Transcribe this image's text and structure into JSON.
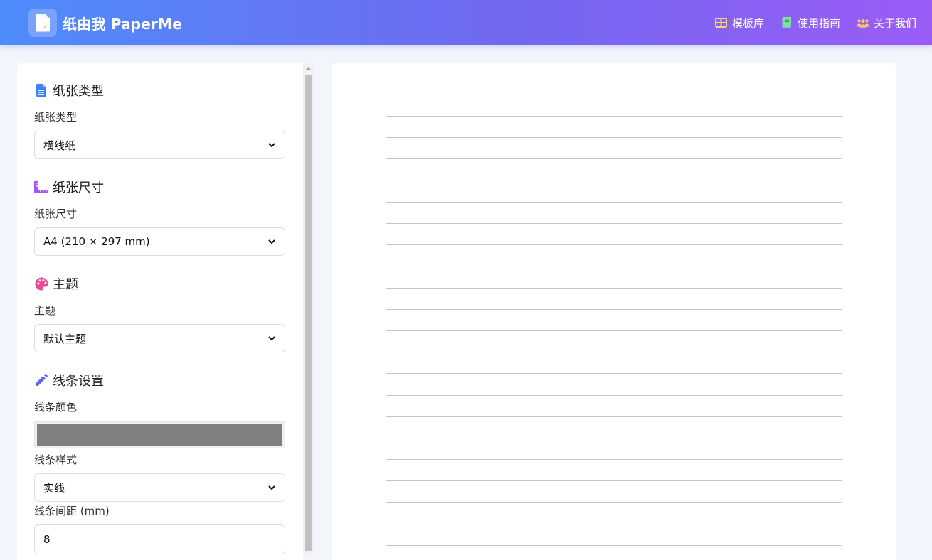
{
  "header": {
    "title": "纸由我 PaperMe",
    "nav": [
      {
        "label": "模板库",
        "icon": "table-icon"
      },
      {
        "label": "使用指南",
        "icon": "book-icon"
      },
      {
        "label": "关于我们",
        "icon": "users-icon"
      }
    ]
  },
  "panel": {
    "paper_type": {
      "title": "纸张类型",
      "label": "纸张类型",
      "value": "横线纸"
    },
    "paper_size": {
      "title": "纸张尺寸",
      "label": "纸张尺寸",
      "value": "A4 (210 × 297 mm)"
    },
    "theme": {
      "title": "主题",
      "label": "主题",
      "value": "默认主题"
    },
    "lines": {
      "title": "线条设置",
      "color_label": "线条颜色",
      "color_value": "#808080",
      "style_label": "线条样式",
      "style_value": "实线",
      "spacing_label": "线条间距 (mm)",
      "spacing_value": "8"
    }
  },
  "colors": {
    "header_gradient_start": "#4f8cfb",
    "header_gradient_end": "#9b5cf6",
    "page_background": "#f3f5fd",
    "ruled_line": "#c4c4c4"
  }
}
